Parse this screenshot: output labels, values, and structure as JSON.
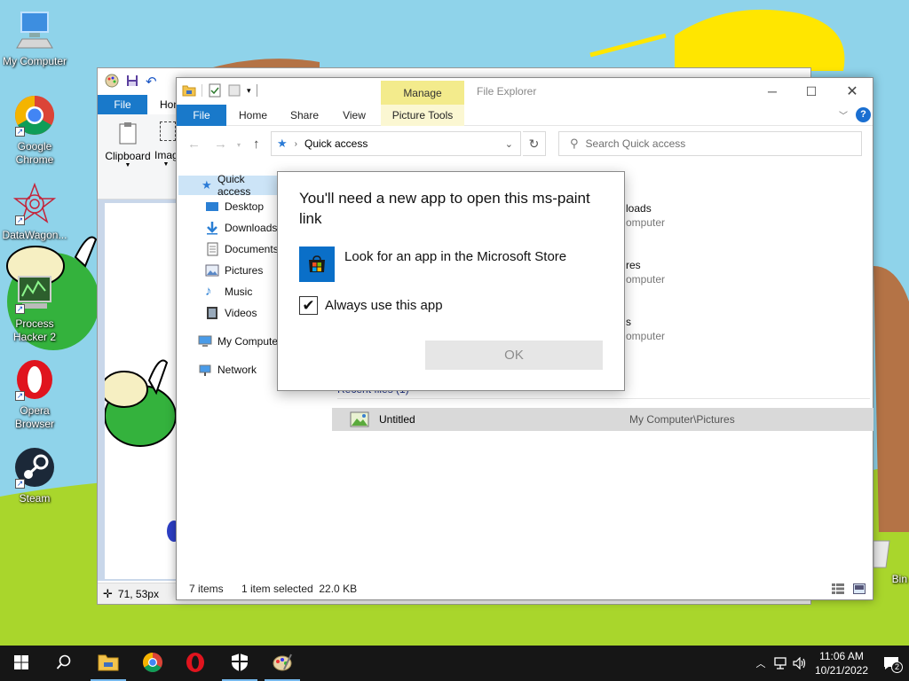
{
  "desktop": {
    "icons": [
      {
        "label": "My Computer"
      },
      {
        "label": "Google Chrome"
      },
      {
        "label": "DataWagon..."
      },
      {
        "label": "Process Hacker 2"
      },
      {
        "label": "Opera Browser"
      },
      {
        "label": "Steam"
      },
      {
        "label": "Bin"
      }
    ]
  },
  "paint": {
    "tabs": {
      "file": "File",
      "home": "Hom"
    },
    "groups": {
      "clipboard": "Clipboard",
      "image": "Imag"
    },
    "status": {
      "coords": "71, 53px"
    }
  },
  "explorer": {
    "title": "File Explorer",
    "manage_tab": "Manage",
    "tabs": {
      "file": "File",
      "home": "Home",
      "share": "Share",
      "view": "View",
      "picture_tools": "Picture Tools"
    },
    "address": {
      "path": "Quick access"
    },
    "search": {
      "placeholder": "Search Quick access"
    },
    "nav": [
      {
        "label": "Quick access"
      },
      {
        "label": "Desktop"
      },
      {
        "label": "Downloads"
      },
      {
        "label": "Documents"
      },
      {
        "label": "Pictures"
      },
      {
        "label": "Music"
      },
      {
        "label": "Videos"
      },
      {
        "label": "My Compute"
      },
      {
        "label": "Network"
      }
    ],
    "folders": [
      {
        "name": "loads",
        "location": "omputer"
      },
      {
        "name": "res",
        "location": "omputer"
      },
      {
        "name": "s",
        "location": "omputer"
      }
    ],
    "recent_header": "Recent files (1)",
    "recent_files": [
      {
        "name": "Untitled",
        "path": "My Computer\\Pictures"
      }
    ],
    "status": {
      "items": "7 items",
      "selected": "1 item selected  22.0 KB"
    }
  },
  "dialog": {
    "heading": "You'll need a new app to open this ms-paint link",
    "store_option": "Look for an app in the Microsoft Store",
    "always_label": "Always use this app",
    "ok_label": "OK"
  },
  "taskbar": {
    "time": "11:06 AM",
    "date": "10/21/2022",
    "notification_count": "2"
  },
  "colors": {
    "accent": "#1979ca",
    "taskbar": "#161616",
    "manage_tab": "#f3eb8c",
    "selection": "#cce4f7"
  }
}
